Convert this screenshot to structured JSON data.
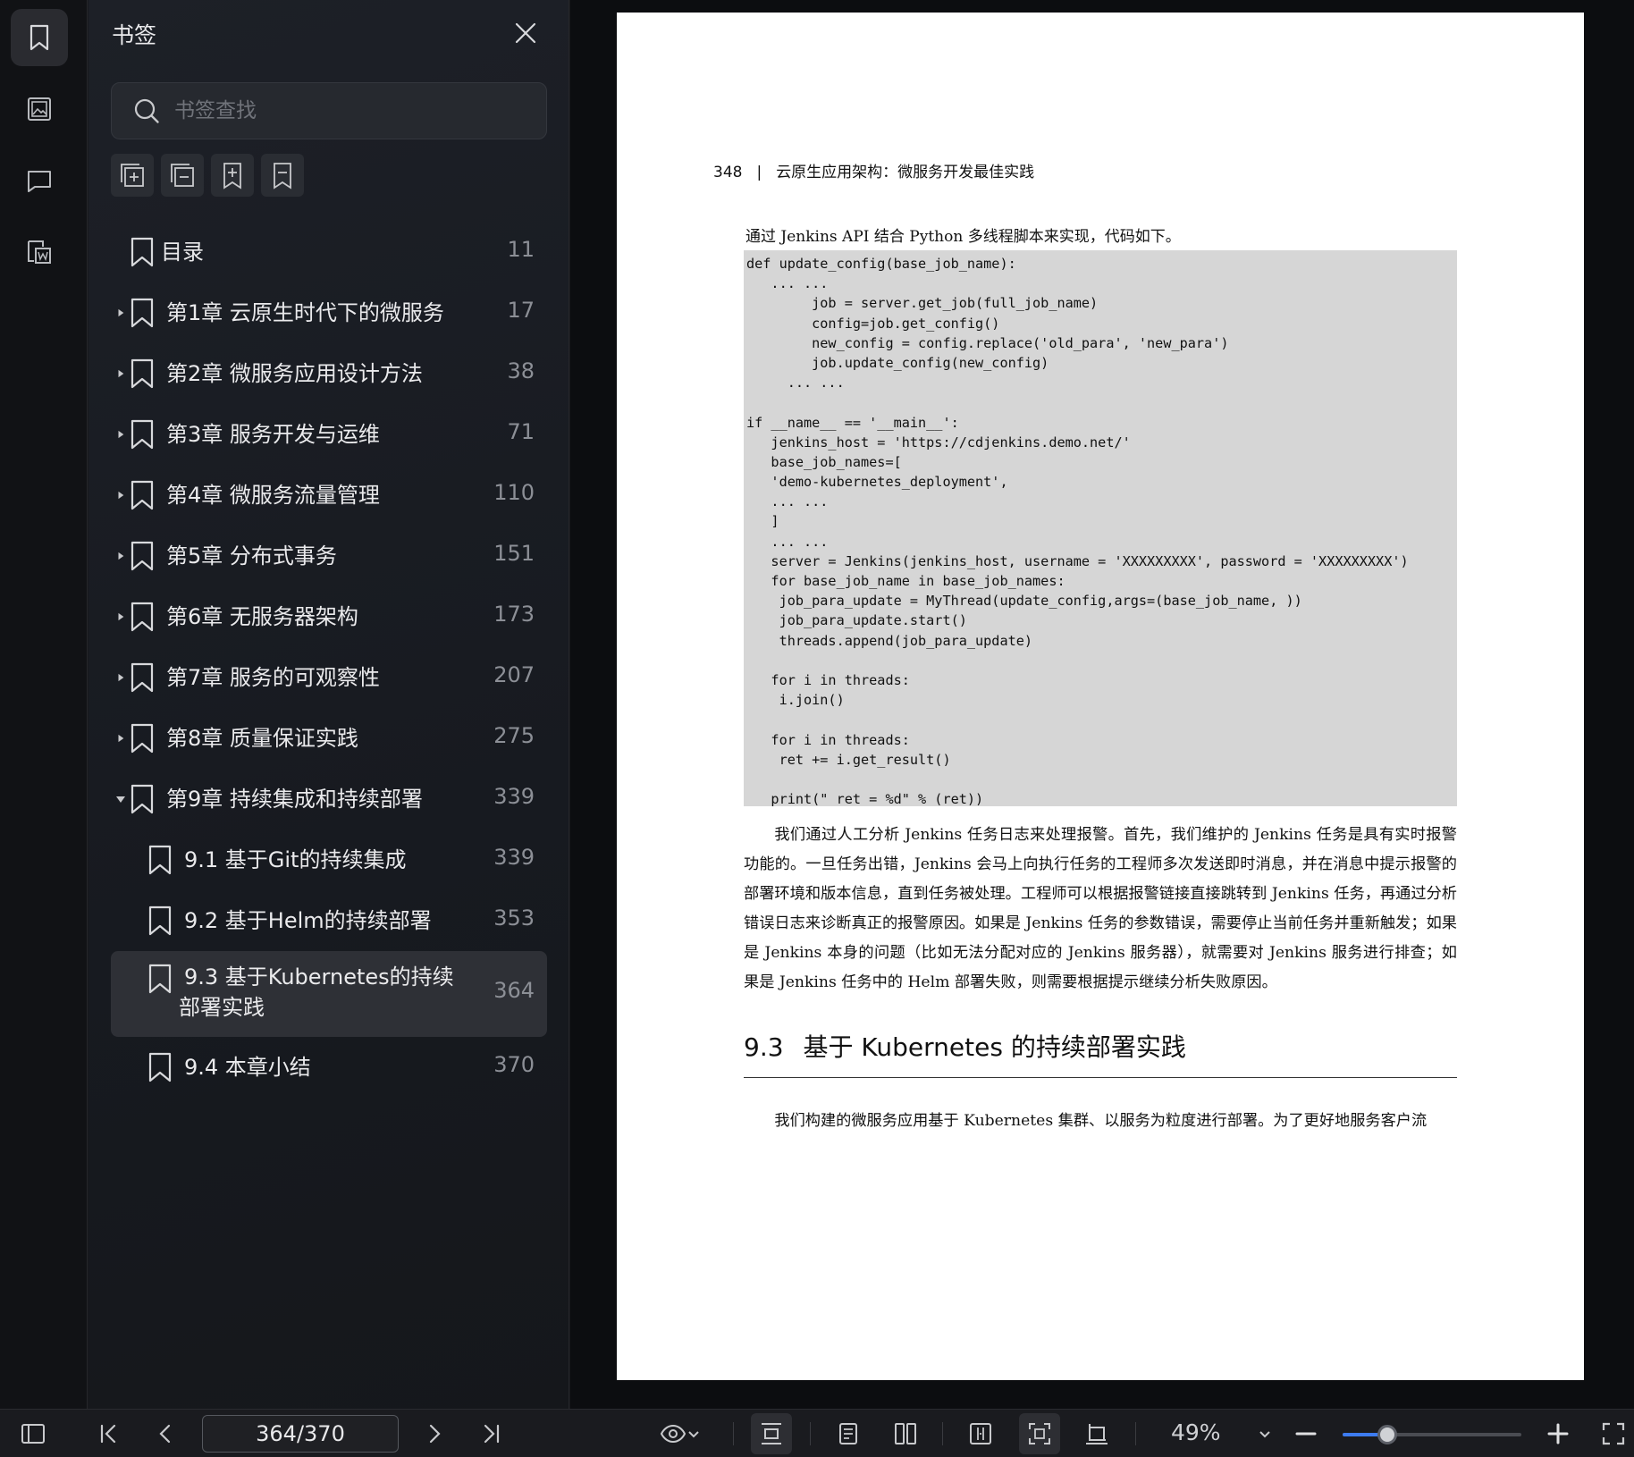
{
  "rail": {
    "items": [
      {
        "name": "bookmark-rail-icon"
      },
      {
        "name": "thumbnail-rail-icon"
      },
      {
        "name": "comment-rail-icon"
      },
      {
        "name": "extract-rail-icon"
      }
    ]
  },
  "panel": {
    "title": "书签",
    "search_placeholder": "书签查找",
    "bookmarks": [
      {
        "label": "目录",
        "page": "11",
        "level": 0,
        "expandable": false
      },
      {
        "label": "第1章 云原生时代下的微服务",
        "page": "17",
        "level": 0,
        "expandable": true,
        "expanded": false
      },
      {
        "label": "第2章 微服务应用设计方法",
        "page": "38",
        "level": 0,
        "expandable": true,
        "expanded": false
      },
      {
        "label": "第3章 服务开发与运维",
        "page": "71",
        "level": 0,
        "expandable": true,
        "expanded": false
      },
      {
        "label": "第4章 微服务流量管理",
        "page": "110",
        "level": 0,
        "expandable": true,
        "expanded": false
      },
      {
        "label": "第5章 分布式事务",
        "page": "151",
        "level": 0,
        "expandable": true,
        "expanded": false
      },
      {
        "label": "第6章 无服务器架构",
        "page": "173",
        "level": 0,
        "expandable": true,
        "expanded": false
      },
      {
        "label": "第7章 服务的可观察性",
        "page": "207",
        "level": 0,
        "expandable": true,
        "expanded": false
      },
      {
        "label": "第8章 质量保证实践",
        "page": "275",
        "level": 0,
        "expandable": true,
        "expanded": false
      },
      {
        "label": "第9章 持续集成和持续部署",
        "page": "339",
        "level": 0,
        "expandable": true,
        "expanded": true
      },
      {
        "label": "9.1 基于Git的持续集成",
        "page": "339",
        "level": 1
      },
      {
        "label": "9.2 基于Helm的持续部署",
        "page": "353",
        "level": 1
      },
      {
        "label": "9.3 基于Kubernetes的持续",
        "label_line2": "部署实践",
        "page": "364",
        "level": 1,
        "selected": true
      },
      {
        "label": "9.4 本章小结",
        "page": "370",
        "level": 1
      }
    ]
  },
  "document": {
    "page_number": "348",
    "running_title": "云原生应用架构：微服务开发最佳实践",
    "intro": "通过 Jenkins API 结合 Python 多线程脚本来实现，代码如下。",
    "code_lines": [
      "def update_config(base_job_name):",
      "   ... ...",
      "        job = server.get_job(full_job_name)",
      "        config=job.get_config()",
      "        new_config = config.replace('old_para', 'new_para')",
      "        job.update_config(new_config)",
      "     ... ...",
      "",
      "if __name__ == '__main__':",
      "   jenkins_host = 'https://cdjenkins.demo.net/'",
      "   base_job_names=[",
      "   'demo-kubernetes_deployment',",
      "   ... ...",
      "   ]",
      "   ... ...",
      "   server = Jenkins(jenkins_host, username = 'XXXXXXXXX', password = 'XXXXXXXXX')",
      "   for base_job_name in base_job_names:",
      "    job_para_update = MyThread(update_config,args=(base_job_name, ))",
      "    job_para_update.start()",
      "    threads.append(job_para_update)",
      "",
      "   for i in threads:",
      "    i.join()",
      "",
      "   for i in threads:",
      "    ret += i.get_result()",
      "",
      "   print(\" ret = %d\" % (ret))"
    ],
    "paragraph": "我们通过人工分析 Jenkins 任务日志来处理报警。首先，我们维护的 Jenkins 任务是具有实时报警功能的。一旦任务出错，Jenkins 会马上向执行任务的工程师多次发送即时消息，并在消息中提示报警的部署环境和版本信息，直到任务被处理。工程师可以根据报警链接直接跳转到 Jenkins 任务，再通过分析错误日志来诊断真正的报警原因。如果是 Jenkins 任务的参数错误，需要停止当前任务并重新触发；如果是 Jenkins 本身的问题（比如无法分配对应的 Jenkins 服务器），就需要对 Jenkins 服务进行排查；如果是 Jenkins 任务中的 Helm 部署失败，则需要根据提示继续分析失败原因。",
    "section_number": "9.3",
    "section_title": "基于 Kubernetes 的持续部署实践",
    "paragraph2": "我们构建的微服务应用基于 Kubernetes 集群、以服务为粒度进行部署。为了更好地服务客户流"
  },
  "toolbar": {
    "page_indicator": "364/370",
    "zoom": "49%",
    "zoom_fraction": 0.25
  }
}
